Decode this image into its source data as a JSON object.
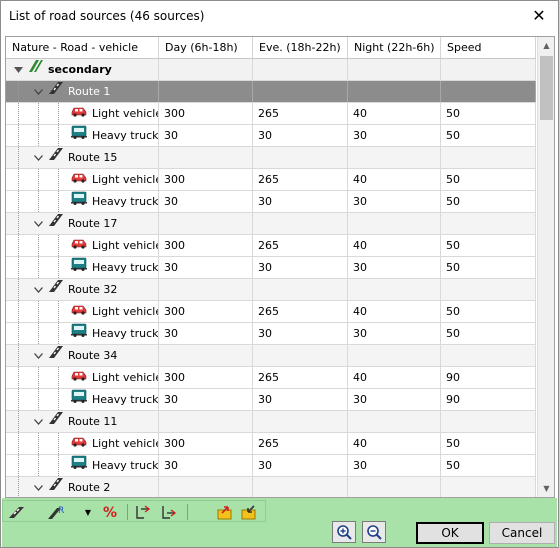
{
  "window": {
    "title": "List of road sources (46 sources)"
  },
  "table": {
    "columns": [
      "Nature - Road - vehicle",
      "Day (6h-18h)",
      "Eve. (18h-22h)",
      "Night (22h-6h)",
      "Speed"
    ],
    "group": {
      "label": "secondary"
    },
    "routes": [
      {
        "name": "Route 1",
        "selected": true,
        "vehicles": [
          {
            "type": "Light vehicles",
            "day": "300",
            "eve": "265",
            "night": "40",
            "speed": "50"
          },
          {
            "type": "Heavy trucks",
            "day": "30",
            "eve": "30",
            "night": "30",
            "speed": "50"
          }
        ]
      },
      {
        "name": "Route 15",
        "selected": false,
        "vehicles": [
          {
            "type": "Light vehicles",
            "day": "300",
            "eve": "265",
            "night": "40",
            "speed": "50"
          },
          {
            "type": "Heavy trucks",
            "day": "30",
            "eve": "30",
            "night": "30",
            "speed": "50"
          }
        ]
      },
      {
        "name": "Route 17",
        "selected": false,
        "vehicles": [
          {
            "type": "Light vehicles",
            "day": "300",
            "eve": "265",
            "night": "40",
            "speed": "50"
          },
          {
            "type": "Heavy trucks",
            "day": "30",
            "eve": "30",
            "night": "30",
            "speed": "50"
          }
        ]
      },
      {
        "name": "Route 32",
        "selected": false,
        "vehicles": [
          {
            "type": "Light vehicles",
            "day": "300",
            "eve": "265",
            "night": "40",
            "speed": "50"
          },
          {
            "type": "Heavy trucks",
            "day": "30",
            "eve": "30",
            "night": "30",
            "speed": "50"
          }
        ]
      },
      {
        "name": "Route 34",
        "selected": false,
        "vehicles": [
          {
            "type": "Light vehicles",
            "day": "300",
            "eve": "265",
            "night": "40",
            "speed": "90"
          },
          {
            "type": "Heavy trucks",
            "day": "30",
            "eve": "30",
            "night": "30",
            "speed": "90"
          }
        ]
      },
      {
        "name": "Route 11",
        "selected": false,
        "vehicles": [
          {
            "type": "Light vehicles",
            "day": "300",
            "eve": "265",
            "night": "40",
            "speed": "50"
          },
          {
            "type": "Heavy trucks",
            "day": "30",
            "eve": "30",
            "night": "30",
            "speed": "50"
          }
        ]
      },
      {
        "name": "Route 2",
        "selected": false,
        "vehicles": []
      }
    ]
  },
  "footer": {
    "ok_label": "OK",
    "cancel_label": "Cancel"
  },
  "colors": {
    "toolbar_bg": "#a8e2a8",
    "selected_row": "#8c8c8c",
    "car_red": "#e03a3a",
    "truck_teal": "#1e7f86"
  }
}
